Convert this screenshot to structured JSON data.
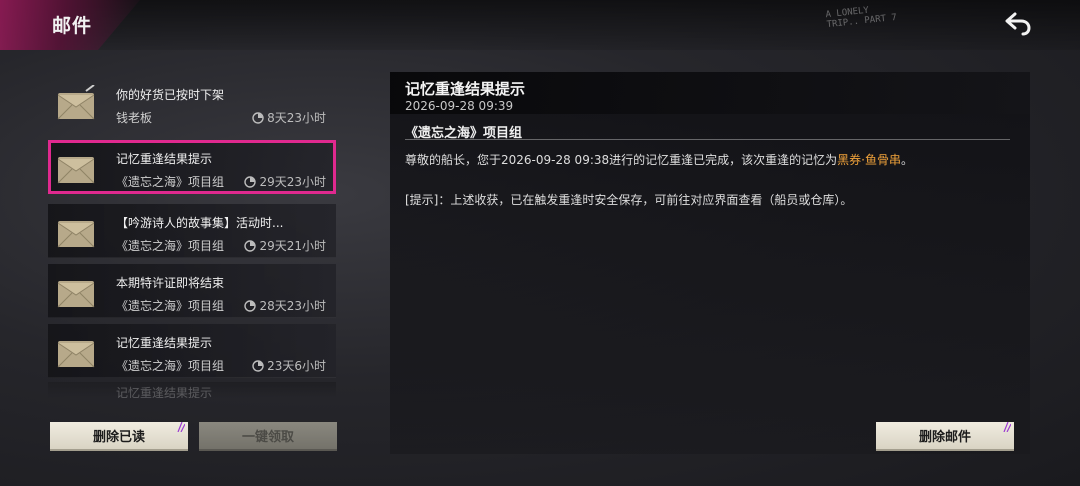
{
  "header": {
    "title": "邮件",
    "decor_text": "A LONELY TRIP.. PART 7"
  },
  "colors": {
    "accent_pink": "#e0298f",
    "highlight_orange": "#f0a23a"
  },
  "icons": {
    "back": "back-arrow-icon",
    "envelope": "envelope-icon",
    "timer": "clock-icon"
  },
  "mails": [
    {
      "title": "你的好货已按时下架",
      "sender": "钱老板",
      "expire": "8天23小时",
      "selected": false
    },
    {
      "title": "记忆重逢结果提示",
      "sender": "《遗忘之海》项目组",
      "expire": "29天23小时",
      "selected": true
    },
    {
      "title": "【吟游诗人的故事集】活动时...",
      "sender": "《遗忘之海》项目组",
      "expire": "29天21小时",
      "selected": false
    },
    {
      "title": "本期特许证即将结束",
      "sender": "《遗忘之海》项目组",
      "expire": "28天23小时",
      "selected": false
    },
    {
      "title": "记忆重逢结果提示",
      "sender": "《遗忘之海》项目组",
      "expire": "23天6小时",
      "selected": false
    }
  ],
  "mail_peek_title": "记忆重逢结果提示",
  "buttons": {
    "delete_read": "删除已读",
    "claim_all": "一键领取",
    "delete_mail": "删除邮件"
  },
  "detail": {
    "title": "记忆重逢结果提示",
    "date": "2026-09-28 09:39",
    "sender": "《遗忘之海》项目组",
    "line1_prefix": "尊敬的船长，您于2026-09-28 09:38进行的记忆重逢已完成，该次重逢的记忆为",
    "line1_highlight": "黑券·鱼骨串",
    "line1_suffix": "。",
    "line2": "[提示]：上述收获，已在触发重逢时安全保存，可前往对应界面查看（船员或仓库）。"
  }
}
